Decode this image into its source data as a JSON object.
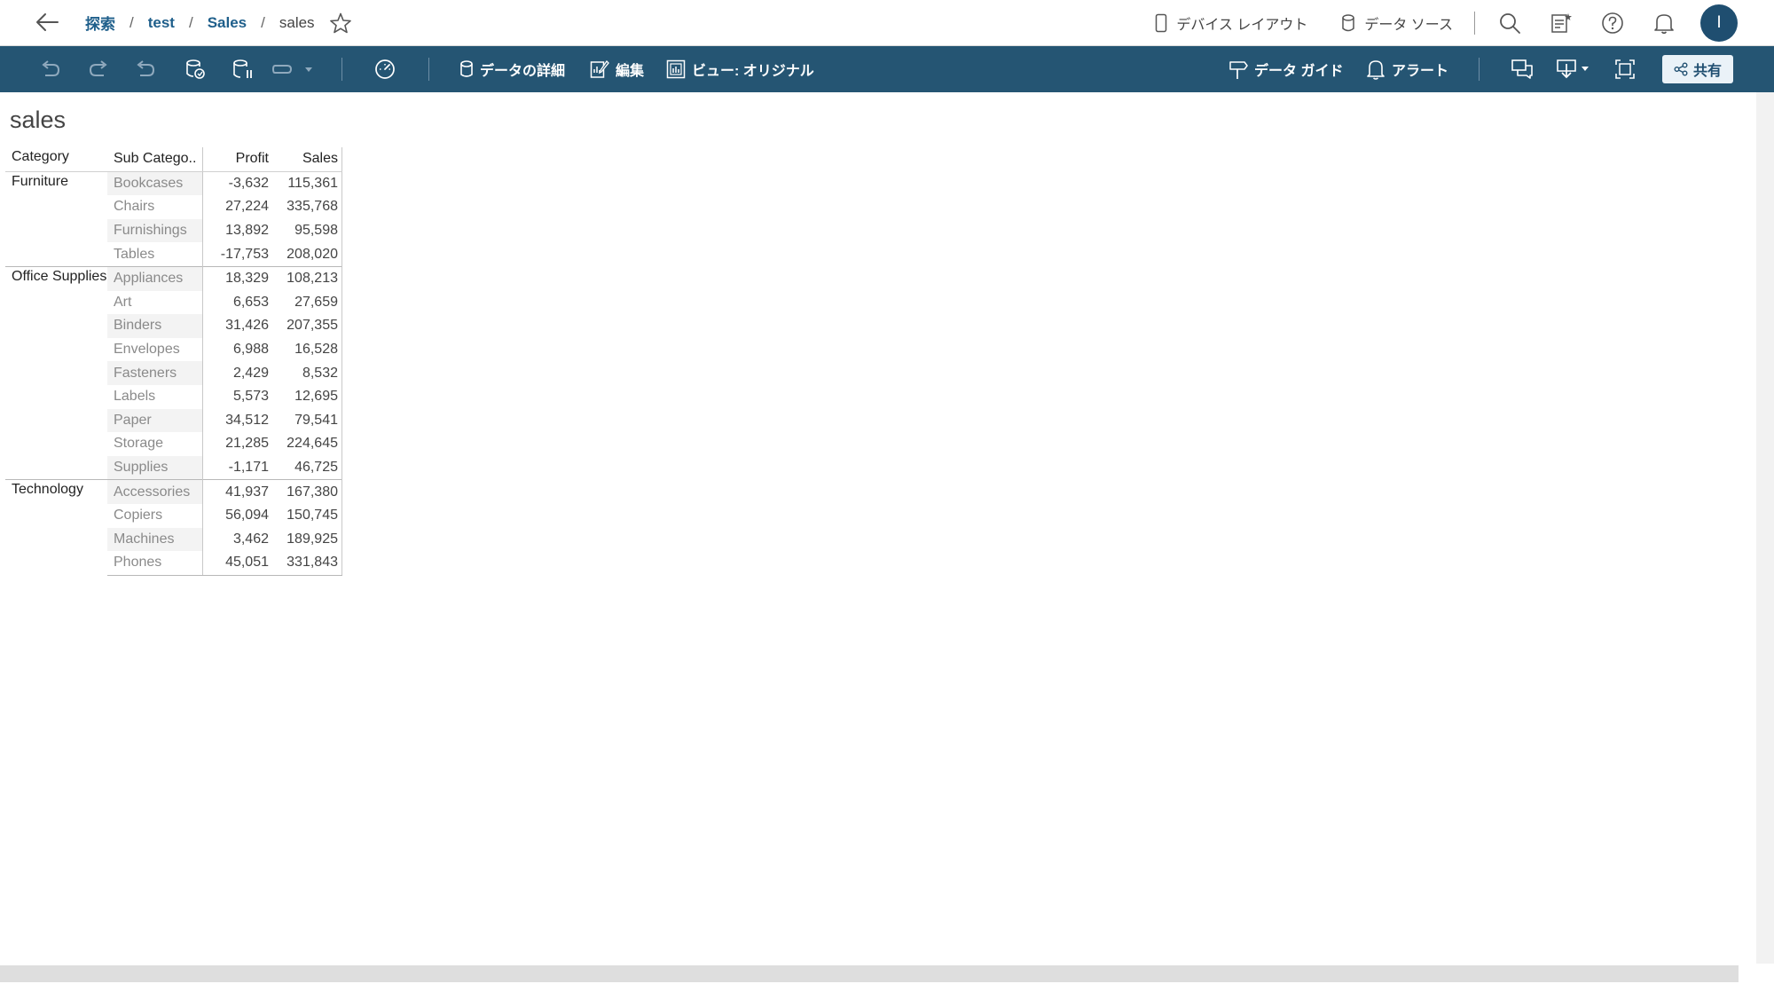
{
  "breadcrumb": {
    "items": [
      "探索",
      "test",
      "Sales"
    ],
    "current": "sales",
    "separator": "/"
  },
  "header": {
    "device_layout": "デバイス レイアウト",
    "data_source": "データ ソース",
    "avatar_initial": "I"
  },
  "toolbar": {
    "data_details": "データの詳細",
    "edit": "編集",
    "view_original": "ビュー: オリジナル",
    "data_guide": "データ ガイド",
    "alert": "アラート",
    "share": "共有"
  },
  "view": {
    "title": "sales"
  },
  "table": {
    "headers": [
      "Category",
      "Sub Catego..",
      "Profit",
      "Sales"
    ],
    "groups": [
      {
        "category": "Furniture",
        "rows": [
          {
            "sub": "Bookcases",
            "profit": "-3,632",
            "sales": "115,361"
          },
          {
            "sub": "Chairs",
            "profit": "27,224",
            "sales": "335,768"
          },
          {
            "sub": "Furnishings",
            "profit": "13,892",
            "sales": "95,598"
          },
          {
            "sub": "Tables",
            "profit": "-17,753",
            "sales": "208,020"
          }
        ]
      },
      {
        "category": "Office Supplies",
        "rows": [
          {
            "sub": "Appliances",
            "profit": "18,329",
            "sales": "108,213"
          },
          {
            "sub": "Art",
            "profit": "6,653",
            "sales": "27,659"
          },
          {
            "sub": "Binders",
            "profit": "31,426",
            "sales": "207,355"
          },
          {
            "sub": "Envelopes",
            "profit": "6,988",
            "sales": "16,528"
          },
          {
            "sub": "Fasteners",
            "profit": "2,429",
            "sales": "8,532"
          },
          {
            "sub": "Labels",
            "profit": "5,573",
            "sales": "12,695"
          },
          {
            "sub": "Paper",
            "profit": "34,512",
            "sales": "79,541"
          },
          {
            "sub": "Storage",
            "profit": "21,285",
            "sales": "224,645"
          },
          {
            "sub": "Supplies",
            "profit": "-1,171",
            "sales": "46,725"
          }
        ]
      },
      {
        "category": "Technology",
        "rows": [
          {
            "sub": "Accessories",
            "profit": "41,937",
            "sales": "167,380"
          },
          {
            "sub": "Copiers",
            "profit": "56,094",
            "sales": "150,745"
          },
          {
            "sub": "Machines",
            "profit": "3,462",
            "sales": "189,925"
          },
          {
            "sub": "Phones",
            "profit": "45,051",
            "sales": "331,843"
          }
        ]
      }
    ]
  }
}
